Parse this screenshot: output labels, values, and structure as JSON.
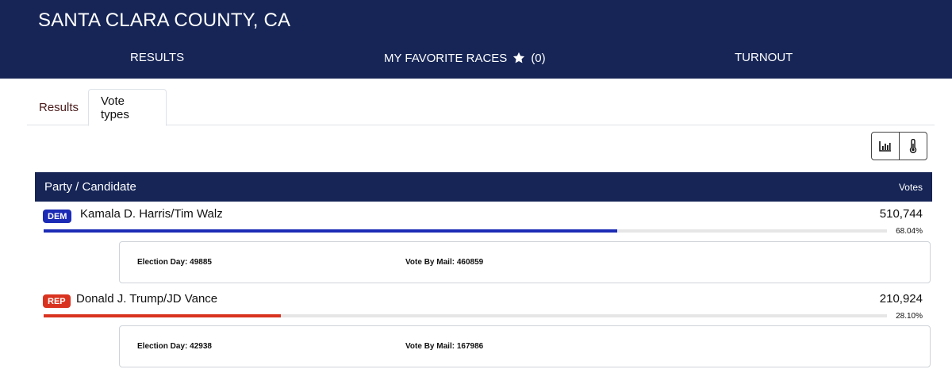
{
  "header": {
    "county": "SANTA CLARA COUNTY, CA",
    "nav": {
      "results": "RESULTS",
      "favorites": "MY FAVORITE RACES",
      "favorites_count": "(0)",
      "turnout": "TURNOUT"
    }
  },
  "tabs": {
    "results": "Results",
    "vote_types": "Vote types",
    "active": "Vote types"
  },
  "view_toggle": {
    "icons": [
      "bar-chart-icon",
      "thermometer-icon"
    ]
  },
  "table": {
    "col_candidate": "Party / Candidate",
    "col_votes": "Votes",
    "rows": [
      {
        "party": "DEM",
        "party_color": "#1c2bb5",
        "candidate": "Kamala D. Harris/Tim Walz",
        "votes": "510,744",
        "percent": "68.04%",
        "percent_value": 68.04,
        "vote_types": [
          {
            "label": "Election Day: 49885"
          },
          {
            "label": "Vote By Mail: 460859"
          }
        ]
      },
      {
        "party": "REP",
        "party_color": "#d9331f",
        "candidate": "Donald J. Trump/JD Vance",
        "votes": "210,924",
        "percent": "28.10%",
        "percent_value": 28.1,
        "vote_types": [
          {
            "label": "Election Day: 42938"
          },
          {
            "label": "Vote By Mail: 167986"
          }
        ]
      }
    ]
  }
}
